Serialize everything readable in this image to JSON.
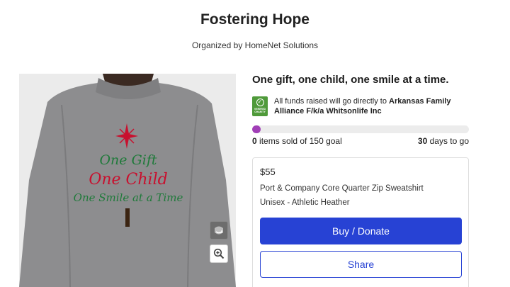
{
  "campaign": {
    "title": "Fostering Hope",
    "organizer": "Organized by HomeNet Solutions"
  },
  "product_image": {
    "print_lines": [
      "One Gift",
      "One Child",
      "One Smile at a Time"
    ]
  },
  "details": {
    "tagline": "One gift, one child, one smile at a time.",
    "badge_text": "VERIFIED CHARITY",
    "funds_prefix": "All funds raised will go directly to ",
    "charity_name": "Arkansas Family Alliance F/k/a Whitsonlife Inc"
  },
  "progress": {
    "percent": 4,
    "color": "#a13fb7",
    "sold_count": "0",
    "sold_suffix": " items sold of 150 goal",
    "days_count": "30",
    "days_suffix": " days to go"
  },
  "product_card": {
    "price": "$55",
    "name_line1": "Port & Company Core Quarter Zip Sweatshirt",
    "name_line2": "Unisex - Athletic Heather",
    "buy_label": "Buy / Donate",
    "share_label": "Share"
  },
  "colors": {
    "primary": "#2742d4",
    "verified_green": "#4f9a3a"
  },
  "icons": {
    "rotate": "rotate-icon",
    "zoom": "zoom-in-icon"
  }
}
